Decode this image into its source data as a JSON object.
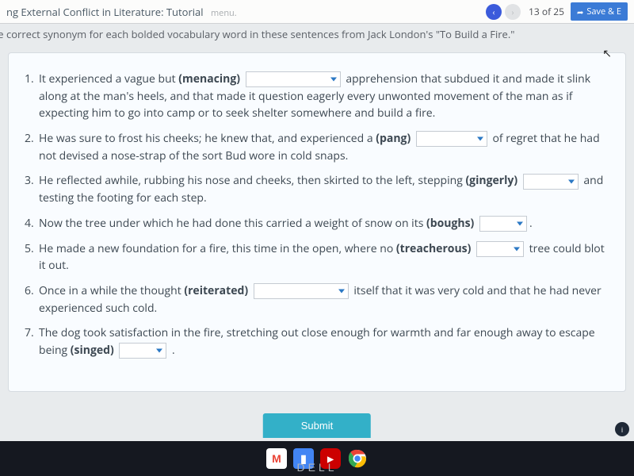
{
  "header": {
    "page_title": "ng External Conflict in Literature: Tutorial",
    "menu_word": "menu.",
    "page_pos": "13  of  25",
    "save_label": "Save & E"
  },
  "instruction": "ose the correct synonym for each bolded vocabulary word in these sentences from Jack London's \"To Build a Fire.\"",
  "questions": [
    {
      "num": "1.",
      "pre": "It experienced a vague but ",
      "bold": "(menacing)",
      "post": " apprehension that subdued it and made it slink along at the man's heels, and that made it question eagerly every unwonted movement of the man as if expecting him to go into camp or to seek shelter somewhere and build a fire."
    },
    {
      "num": "2.",
      "pre": "He was sure to frost his cheeks; he knew that, and experienced a ",
      "bold": "(pang)",
      "post": " of regret that he had not devised a nose-strap of the sort Bud wore in cold snaps."
    },
    {
      "num": "3.",
      "pre": "He reflected awhile, rubbing his nose and cheeks, then skirted to the left, stepping ",
      "bold": "(gingerly)",
      "post": " and testing the footing for each step."
    },
    {
      "num": "4.",
      "pre": "Now the tree under which he had done this carried a weight of snow on its ",
      "bold": "(boughs)",
      "post": "."
    },
    {
      "num": "5.",
      "pre": "He made a new foundation for a fire, this time in the open, where no ",
      "bold": "(treacherous)",
      "post": " tree could blot it out."
    },
    {
      "num": "6.",
      "pre": "Once in a while the thought ",
      "bold": "(reiterated)",
      "post": " itself that it was very cold and that he had never experienced such cold."
    },
    {
      "num": "7.",
      "pre": "The dog took satisfaction in the fire, stretching out close enough for warmth and far enough away to escape being ",
      "bold": "(singed)",
      "post": " ."
    }
  ],
  "submit_label": "Submit",
  "brand": "DELL",
  "taskbar": {
    "gmail": "M",
    "docs": "▮",
    "youtube": "▶",
    "chrome": "◉"
  }
}
